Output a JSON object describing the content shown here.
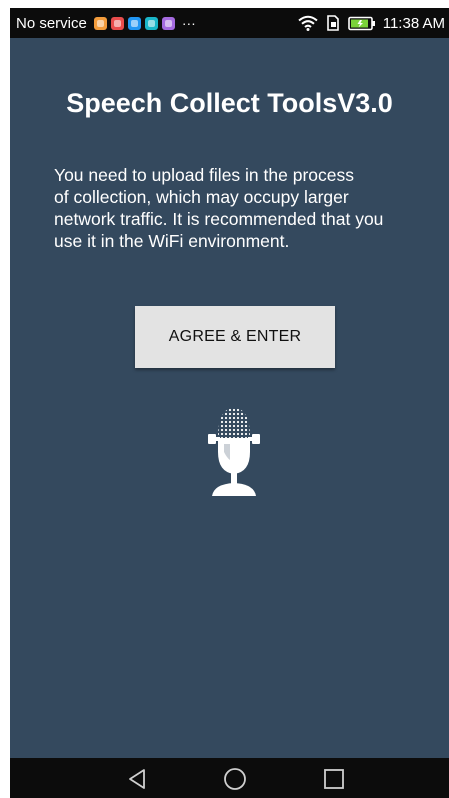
{
  "status_bar": {
    "carrier": "No service",
    "overflow": "···",
    "time": "11:38 AM",
    "notification_icons": [
      {
        "name": "browser-icon",
        "color": "#f39c3c"
      },
      {
        "name": "red-app-icon",
        "color": "#e84c4c"
      },
      {
        "name": "blue-app-icon",
        "color": "#2196f3"
      },
      {
        "name": "teal-app-icon",
        "color": "#1ab6c9"
      },
      {
        "name": "purple-app-icon",
        "color": "#a56be0"
      }
    ]
  },
  "main": {
    "title": "Speech Collect ToolsV3.0",
    "notice_lines": [
      "You need to upload files in the process",
      "of collection, which may occupy larger",
      "network traffic. It is recommended that you",
      "use it in the WiFi environment."
    ],
    "agree_button_label": "AGREE & ENTER",
    "illustration": "microphone-icon"
  },
  "nav_bar": {
    "buttons": [
      "back-icon",
      "home-icon",
      "recents-icon"
    ]
  },
  "colors": {
    "background": "#34495e",
    "bars": "#0c0c0c",
    "button": "#e3e3e3",
    "text": "#ffffff"
  }
}
